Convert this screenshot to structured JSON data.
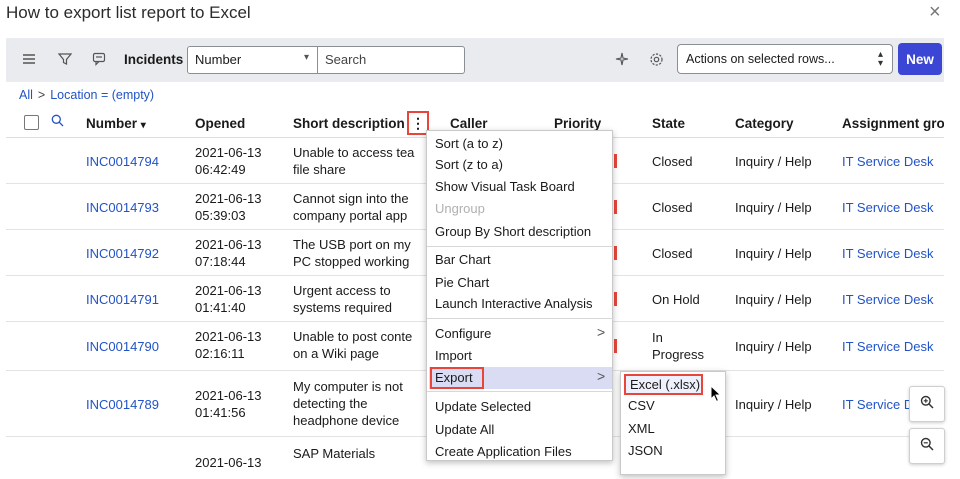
{
  "window": {
    "title": "How to export list report to Excel",
    "close_glyph": "×"
  },
  "toolbar": {
    "title": "Incidents",
    "field_select": "Number",
    "search_placeholder": "Search",
    "actions_select": "Actions on selected rows...",
    "new_label": "New"
  },
  "breadcrumb": {
    "all": "All",
    "sep": ">",
    "filter": "Location = (empty)"
  },
  "columns": {
    "number": "Number",
    "opened": "Opened",
    "short_description": "Short description",
    "caller": "Caller",
    "priority": "Priority",
    "state": "State",
    "category": "Category",
    "assignment_group": "Assignment grou"
  },
  "rows": [
    {
      "number": "INC0014794",
      "date": "2021-06-13",
      "time": "06:42:49",
      "desc1": "Unable to access tea",
      "desc2": "file share",
      "state1": "Closed",
      "state2": "",
      "category": "Inquiry / Help",
      "group": "IT Service Desk"
    },
    {
      "number": "INC0014793",
      "date": "2021-06-13",
      "time": "05:39:03",
      "desc1": "Cannot sign into the",
      "desc2": "company portal app",
      "state1": "Closed",
      "state2": "",
      "category": "Inquiry / Help",
      "group": "IT Service Desk"
    },
    {
      "number": "INC0014792",
      "date": "2021-06-13",
      "time": "07:18:44",
      "desc1": "The USB port on my",
      "desc2": "PC stopped working",
      "state1": "Closed",
      "state2": "",
      "category": "Inquiry / Help",
      "group": "IT Service Desk"
    },
    {
      "number": "INC0014791",
      "date": "2021-06-13",
      "time": "01:41:40",
      "desc1": "Urgent access to",
      "desc2": "systems required",
      "state1": "On Hold",
      "state2": "",
      "category": "Inquiry / Help",
      "group": "IT Service Desk"
    },
    {
      "number": "INC0014790",
      "date": "2021-06-13",
      "time": "02:16:11",
      "desc1": "Unable to post conte",
      "desc2": "on a Wiki page",
      "state1": "In",
      "state2": "Progress",
      "category": "Inquiry / Help",
      "group": "IT Service Desk"
    },
    {
      "number": "INC0014789",
      "date": "2021-06-13",
      "time": "01:41:56",
      "desc1": "My computer is not",
      "desc2": "detecting the",
      "desc3": "headphone device",
      "state1": "",
      "state2": "",
      "category": "Inquiry / Help",
      "group": "IT Service D"
    },
    {
      "number": "",
      "date": "2021-06-13",
      "time": "",
      "desc1": "SAP Materials",
      "desc2": "",
      "state1": "",
      "state2": "",
      "category": "",
      "group": ""
    }
  ],
  "context_menu": {
    "sort_az": "Sort (a to z)",
    "sort_za": "Sort (z to a)",
    "visual_task_board": "Show Visual Task Board",
    "ungroup": "Ungroup",
    "group_by": "Group By Short description",
    "bar_chart": "Bar Chart",
    "pie_chart": "Pie Chart",
    "interactive_analysis": "Launch Interactive Analysis",
    "configure": "Configure",
    "import": "Import",
    "export": "Export",
    "update_selected": "Update Selected",
    "update_all": "Update All",
    "create_app_files": "Create Application Files",
    "chevron": ">"
  },
  "export_submenu": {
    "excel": "Excel (.xlsx)",
    "csv": "CSV",
    "xml": "XML",
    "json": "JSON"
  },
  "colors": {
    "accent": "#3b47d4",
    "link": "#2153c5",
    "highlight_border": "#e8463a",
    "toolbar_bg": "#e9ebee"
  },
  "icons": [
    "hamburger-icon",
    "filter-icon",
    "chat-icon",
    "search-icon",
    "sort-desc-icon",
    "sparkle-icon",
    "gear-icon",
    "zoom-icon",
    "cursor-icon"
  ]
}
